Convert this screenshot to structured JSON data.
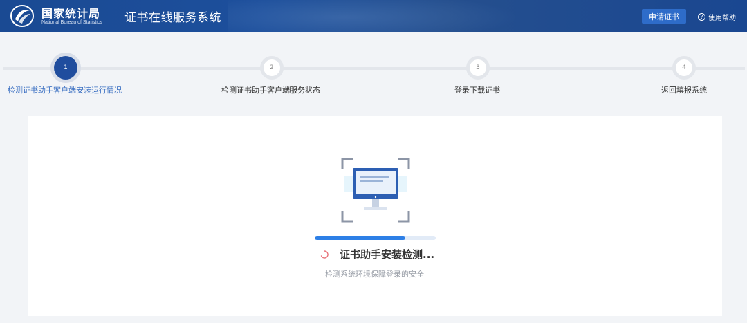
{
  "header": {
    "brand_cn": "国家统计局",
    "brand_en": "National Bureau of Statistics",
    "system_title": "证书在线服务系统",
    "apply_button": "申请证书",
    "help_icon_glyph": "?",
    "help_label": "使用帮助"
  },
  "steps": [
    {
      "number": "1",
      "label": "检测证书助手客户端安装运行情况",
      "state": "active"
    },
    {
      "number": "2",
      "label": "检测证书助手客户端服务状态",
      "state": "inactive"
    },
    {
      "number": "3",
      "label": "登录下载证书",
      "state": "inactive"
    },
    {
      "number": "4",
      "label": "返回填报系统",
      "state": "inactive"
    }
  ],
  "detection": {
    "title": "证书助手安装检测...",
    "subtitle": "检测系统环境保障登录的安全",
    "progress_percent": 75,
    "illustration_icon": "monitor-scan-icon"
  },
  "colors": {
    "header_bg": "#1d4f9c",
    "active_step": "#1f4d9e",
    "active_label": "#3a6fc2",
    "progress": "#2d7fe6",
    "spinner": "#e8737a"
  }
}
